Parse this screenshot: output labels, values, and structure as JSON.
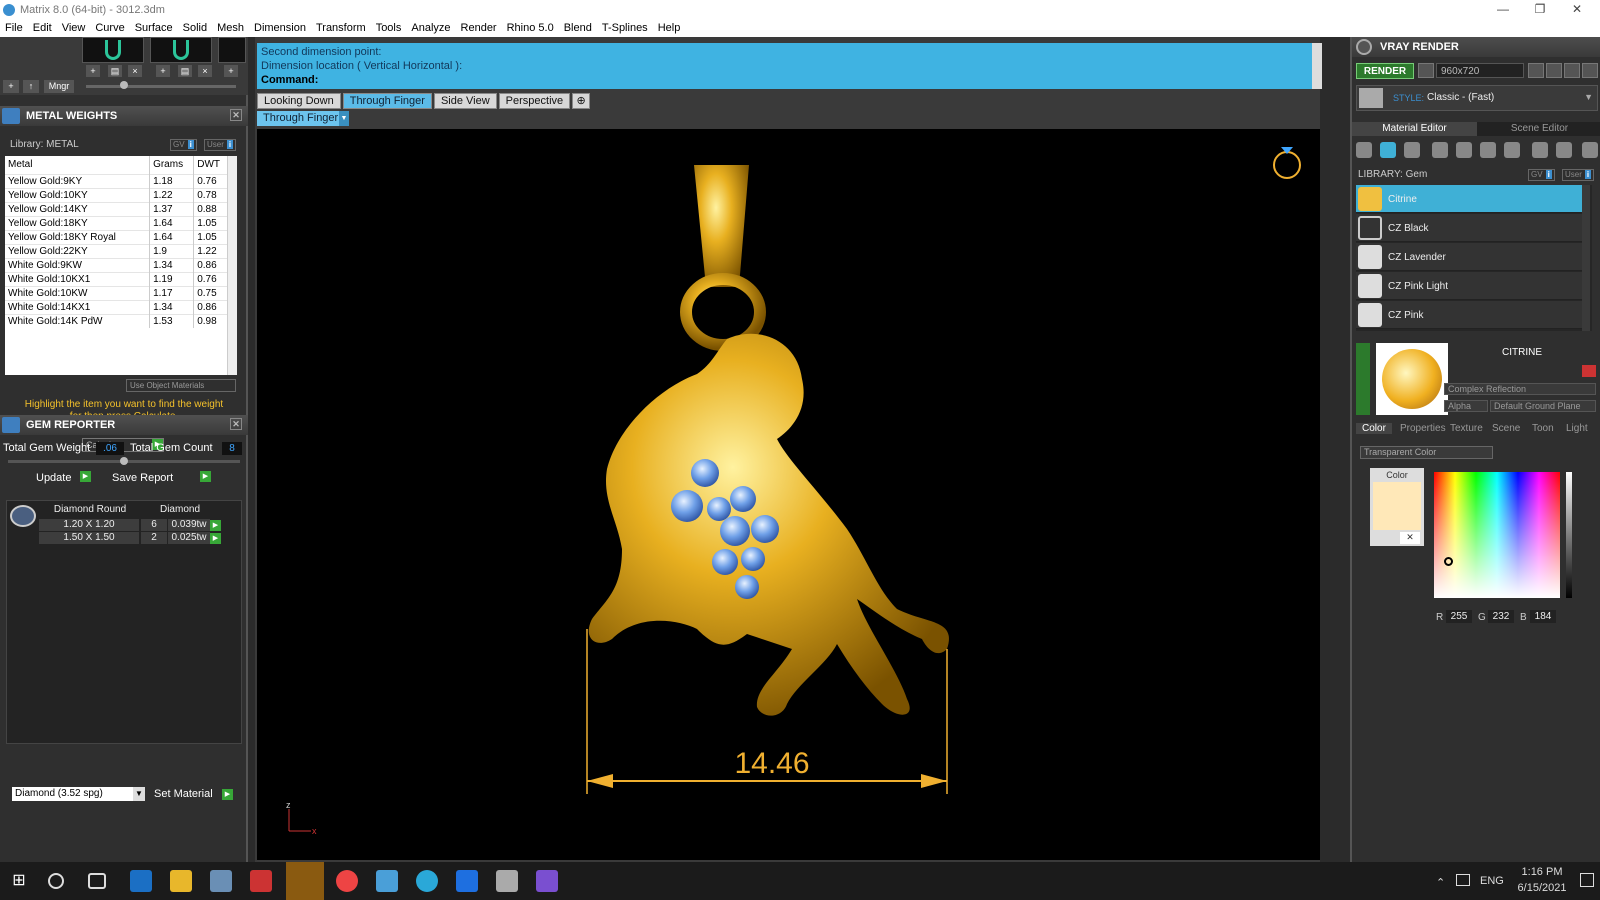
{
  "window": {
    "title": "Matrix 8.0 (64-bit) - 3012.3dm"
  },
  "menu": [
    "File",
    "Edit",
    "View",
    "Curve",
    "Surface",
    "Solid",
    "Mesh",
    "Dimension",
    "Transform",
    "Tools",
    "Analyze",
    "Render",
    "Rhino 5.0",
    "Blend",
    "T-Splines",
    "Help"
  ],
  "toolstrip": {
    "mngr": "Mngr"
  },
  "metal_weights": {
    "title": "METAL WEIGHTS",
    "library": "Library: METAL",
    "gv": "GV",
    "user": "User",
    "columns": [
      "Metal",
      "Grams",
      "DWT"
    ],
    "rows": [
      [
        "Yellow Gold:9KY",
        "1.18",
        "0.76"
      ],
      [
        "Yellow Gold:10KY",
        "1.22",
        "0.78"
      ],
      [
        "Yellow Gold:14KY",
        "1.37",
        "0.88"
      ],
      [
        "Yellow Gold:18KY",
        "1.64",
        "1.05"
      ],
      [
        "Yellow Gold:18KY Royal",
        "1.64",
        "1.05"
      ],
      [
        "Yellow Gold:22KY",
        "1.9",
        "1.22"
      ],
      [
        "White Gold:9KW",
        "1.34",
        "0.86"
      ],
      [
        "White Gold:10KX1",
        "1.19",
        "0.76"
      ],
      [
        "White Gold:10KW",
        "1.17",
        "0.75"
      ],
      [
        "White Gold:14KX1",
        "1.34",
        "0.86"
      ],
      [
        "White Gold:14K PdW",
        "1.53",
        "0.98"
      ]
    ],
    "use_object_materials": "Use Object Materials",
    "hint_line1": "Highlight the item you want to find the weight",
    "hint_line2": "for then press Calculate.",
    "calculate": "Calculate"
  },
  "gem_reporter": {
    "title": "GEM REPORTER",
    "total_weight_label": "Total Gem Weight",
    "total_weight": ".06",
    "total_count_label": "Total Gem Count",
    "total_count": "8",
    "update": "Update",
    "save_report": "Save Report",
    "col1": "Diamond Round",
    "col2": "Diamond",
    "rows": [
      {
        "size": "1.20 X 1.20",
        "count": "6",
        "tw": "0.039tw"
      },
      {
        "size": "1.50 X 1.50",
        "count": "2",
        "tw": "0.025tw"
      }
    ],
    "material_select": "Diamond    (3.52 spg)",
    "set_material": "Set Material"
  },
  "command": {
    "line1": "Second dimension point:",
    "line2": "Dimension location ( Vertical  Horizontal ):",
    "line3": "Command:"
  },
  "view_tabs": [
    "Looking Down",
    "Through Finger",
    "Side View",
    "Perspective"
  ],
  "active_tab": "Through Finger",
  "viewport_label": "Through Finger",
  "dimension": "14.46",
  "axis": {
    "z": "z",
    "x": "x"
  },
  "vray": {
    "title": "VRAY RENDER",
    "render": "RENDER",
    "resolution": "960x720",
    "style_label": "STYLE:",
    "style_value": "Classic - (Fast)",
    "material_editor": "Material Editor",
    "scene_editor": "Scene Editor",
    "library": "LIBRARY: Gem",
    "materials": [
      "Citrine",
      "CZ Black",
      "CZ Lavender",
      "CZ Pink Light",
      "CZ Pink"
    ],
    "selected_material": "CITRINE",
    "reflection": "Complex Reflection",
    "alpha": "Alpha",
    "ground": "Default Ground Plane",
    "tabs": [
      "Color",
      "Properties",
      "Texture",
      "Scene",
      "Toon",
      "Light"
    ],
    "transparent_color": "Transparent Color",
    "color_label": "Color",
    "swatch_color": "#FFE8B8",
    "r_label": "R",
    "r": "255",
    "g_label": "G",
    "g": "232",
    "b_label": "B",
    "b": "184"
  },
  "taskbar": {
    "lang": "ENG",
    "time": "1:16 PM",
    "date": "6/15/2021"
  },
  "colors": {
    "gold": "#E8B020",
    "accent": "#3FB3E2",
    "dimension": "#F0B030"
  }
}
